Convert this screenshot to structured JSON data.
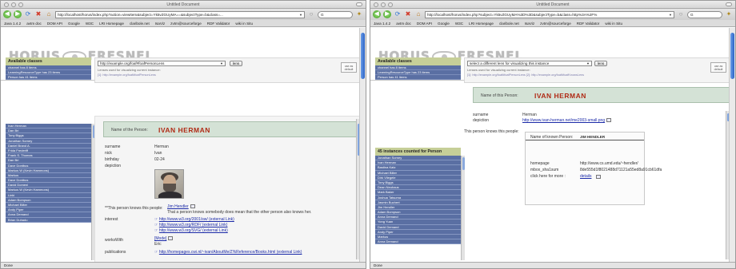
{
  "left": {
    "window_title": "Untitled Document",
    "url": "http://localhost/horus/index.php?action=viewItem&subject=Yk5vZGUyMA==&subjectType=b&class=... ",
    "search_placeholder": "",
    "bookmarks": [
      "Java 1.4.2",
      "avtm doc",
      "DOM API",
      "Google",
      "W3C",
      "LRI Homepage",
      "claribole.net",
      "IsaViz",
      "zvtm@sourceforge",
      "RDF Validator",
      "wiki in Situ"
    ],
    "logo_text_a": "HORUS",
    "logo_text_b": "FRESNEL",
    "kb_links": {
      "prefix": "view knowledge base",
      "n3": "[as N3]",
      "statements": "[as statements]",
      "sep": "|",
      "view_fresnel": "view fresnel"
    },
    "sidebar": {
      "title": "Available classes",
      "items": [
        "channel has 8 items",
        "LearningResourceType has 23 items",
        "Person has 41 items"
      ]
    },
    "lens": {
      "selected": "http://example.org/foaf#foafPersonLens",
      "button": "lens",
      "note": "Lenses used for visualizing current instance:",
      "link": "[1]: http://example.org/foaf#foafPersonLens",
      "use_default": "use as default"
    },
    "instances": [
      "Ivan Herman",
      "Dan Bri",
      "Tony Biggs",
      "Jonathan Sorney",
      "Daniel Brand A.",
      "Frida Frederiff",
      "Frank S. Thomas",
      "Dan Bri",
      "Dave Dontbus",
      "Markus W (Kevin Hammons)",
      "Markus",
      "Dave Dontbus",
      "David Domeni",
      "Markus W (Kevin Hammons)",
      "Linki",
      "Adam Bompson",
      "Michael Bilter",
      "Andy Piper",
      "Anna Demand",
      "Brian Duhadu"
    ],
    "person": {
      "name_label": "Name of the Person:",
      "name": "IVAN HERMAN",
      "props": [
        {
          "k": "surname",
          "v": "Herman"
        },
        {
          "k": "nick",
          "v": "Ivan"
        },
        {
          "k": "birthday",
          "v": "02-24"
        },
        {
          "k": "depiction",
          "v": ""
        }
      ],
      "knows_label": "**This person knows this people:",
      "knows_link": "Jim Hendler",
      "knows_note": "That a person knows somebody does mean that the other person also knows her.",
      "interest_label": "interest",
      "interest_links": [
        "http://www.w3.org/2001/sw/ (external Link)",
        "http://www.w3.org/RDF/ (external Link)",
        "http://www.w3.org/SVG/ (external Link)"
      ],
      "worksWith_label": "worksWith",
      "worksWith_link": "[Mode]",
      "worksWith_sub": "Eric",
      "publications_label": "publications",
      "publications_link": "http://homepages.cwi.nl/~ivan/AboutMe/Z%Reference/Books.html (external Link)"
    },
    "status": "Done"
  },
  "right": {
    "window_title": "Untitled Document",
    "url": "http://localhost/horus/index.php?subject=Yk5vZGUyMA%3D%3D&subjectType=b&class=http%3A%2F%",
    "search_placeholder": "",
    "bookmarks": [
      "Java 1.4.2",
      "avtm doc",
      "DOM API",
      "Google",
      "W3C",
      "LRI Homepage",
      "claribole.net",
      "IsaViz",
      "zvtm@sourceforge",
      "RDF Validator",
      "wiki in Situ"
    ],
    "logo_text_a": "HORUS",
    "logo_text_b": "FRESNEL",
    "kb_links": {
      "prefix": "view knowledge base",
      "n3": "[as N3]",
      "statements": "[as statements]",
      "sep": "|",
      "view_fresnel": "view fresr"
    },
    "sidebar": {
      "title": "Available classes",
      "items": [
        "channel has 8 items",
        "LearningResourceType has 23 items",
        "Person has 41 items"
      ]
    },
    "lens": {
      "selected": "select a different lens for visualizing this instance",
      "button": "lens",
      "note": "Lenses used for visualizing current instance:",
      "link": "[1]: http://example.org/foaf#foafPersonLens [2]: http://example.org/foaf#foafKnowsLens",
      "use_default": "use as default"
    },
    "instances_title": "45 instances counted for Person",
    "instances": [
      "Jonathan Sorney",
      "Ivan Herman",
      "Bastina Katz",
      "Michael Bilter",
      "Dirk Vliegele",
      "Tony Biggs",
      "Dean Neuhaus",
      "Mark Baker",
      "Joshua Tatsuma",
      "Jasmin Buchert",
      "Jim Hendler",
      "Adam Bompson",
      "Anna Demand",
      "Yong Yuan",
      "David Demand",
      "Andy Piper",
      "Markus",
      "Anna Demand"
    ],
    "person": {
      "name_label": "Name of this Person:",
      "name": "IVAN HERMAN",
      "props": [
        {
          "k": "surname",
          "v": "Herman"
        },
        {
          "k": "depiction",
          "v": "http://www.ivan-herman.net/me2003-small.png"
        }
      ],
      "knows_label": "This person knows this people:",
      "known_name_label": "Name of known Person:",
      "known_name": "JIM HENDLER",
      "known_props": [
        {
          "k": "homepage",
          "v": "http://www.cs.umd.edu/~hendler/"
        },
        {
          "k": "mbox_sha1sum",
          "v": "8de555d1f8021488d71121a55ed8a91cb61dfa"
        },
        {
          "k": "click here for more :",
          "v": "details"
        }
      ]
    },
    "status": "Done"
  }
}
